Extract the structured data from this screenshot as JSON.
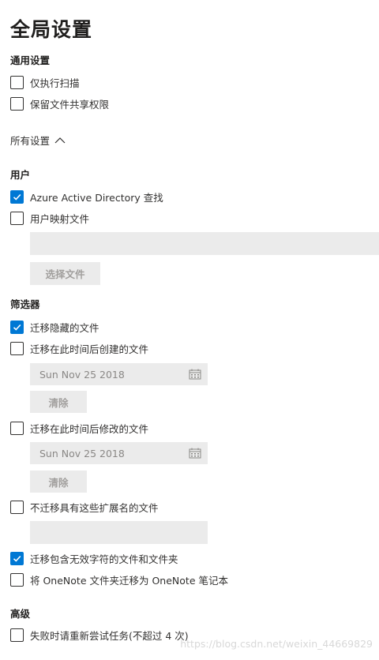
{
  "page": {
    "title": "全局设置"
  },
  "sections": {
    "general": "通用设置",
    "all_settings": "所有设置",
    "users": "用户",
    "filters": "筛选器",
    "advanced": "高级"
  },
  "general": {
    "scan_only": {
      "label": "仅执行扫描",
      "checked": false
    },
    "preserve_share_perms": {
      "label": "保留文件共享权限",
      "checked": false
    }
  },
  "users": {
    "azure_ad_lookup": {
      "label": "Azure Active Directory 查找",
      "checked": true
    },
    "user_mapping_file": {
      "label": "用户映射文件",
      "checked": false
    },
    "file_path_value": "",
    "choose_file_button": "选择文件"
  },
  "filters": {
    "migrate_hidden": {
      "label": "迁移隐藏的文件",
      "checked": true
    },
    "created_after": {
      "label": "迁移在此时间后创建的文件",
      "checked": false,
      "date": "Sun Nov 25 2018",
      "clear_button": "清除"
    },
    "modified_after": {
      "label": "迁移在此时间后修改的文件",
      "checked": false,
      "date": "Sun Nov 25 2018",
      "clear_button": "清除"
    },
    "exclude_extensions": {
      "label": "不迁移具有这些扩展名的文件",
      "checked": false,
      "value": ""
    },
    "invalid_chars": {
      "label": "迁移包含无效字符的文件和文件夹",
      "checked": true
    },
    "onenote": {
      "label": "将 OneNote 文件夹迁移为 OneNote 笔记本",
      "checked": false
    }
  },
  "advanced": {
    "retry_failed": {
      "label": "失败时请重新尝试任务(不超过 4 次)",
      "checked": false
    }
  },
  "watermark": "https://blog.csdn.net/weixin_44669829",
  "colors": {
    "accent": "#0078d4",
    "field_bg": "#ebebeb"
  }
}
